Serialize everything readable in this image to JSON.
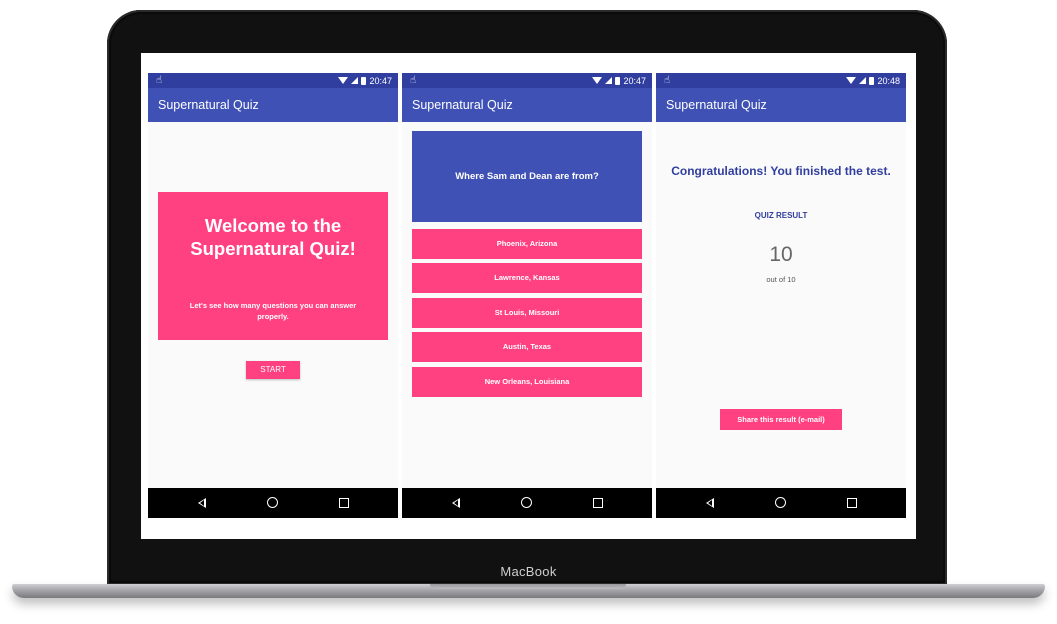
{
  "device": {
    "brand": "MacBook"
  },
  "colors": {
    "primary": "#3f51b5",
    "primary_dark": "#303f9f",
    "accent": "#ff4081",
    "background": "#fafafa"
  },
  "screens": [
    {
      "status": {
        "time": "20:47",
        "left_icon": "touch-icon"
      },
      "appbar": {
        "title": "Supernatural Quiz"
      },
      "welcome": {
        "title_line1": "Welcome to the",
        "title_line2": "Supernatural Quiz!",
        "subtitle": "Let's see how many questions you can answer properly."
      },
      "start_label": "START"
    },
    {
      "status": {
        "time": "20:47",
        "left_icon": "touch-icon"
      },
      "appbar": {
        "title": "Supernatural Quiz"
      },
      "question": "Where Sam and Dean are from?",
      "answers": [
        "Phoenix, Arizona",
        "Lawrence, Kansas",
        "St Louis, Missouri",
        "Austin, Texas",
        "New Orleans, Louisiana"
      ]
    },
    {
      "status": {
        "time": "20:48",
        "left_icon": "touch-icon"
      },
      "appbar": {
        "title": "Supernatural Quiz"
      },
      "congrats": "Congratulations! You finished the test.",
      "result_label": "QUIZ RESULT",
      "score": "10",
      "out_of": "out of 10",
      "share_label": "Share this result (e-mail)"
    }
  ]
}
